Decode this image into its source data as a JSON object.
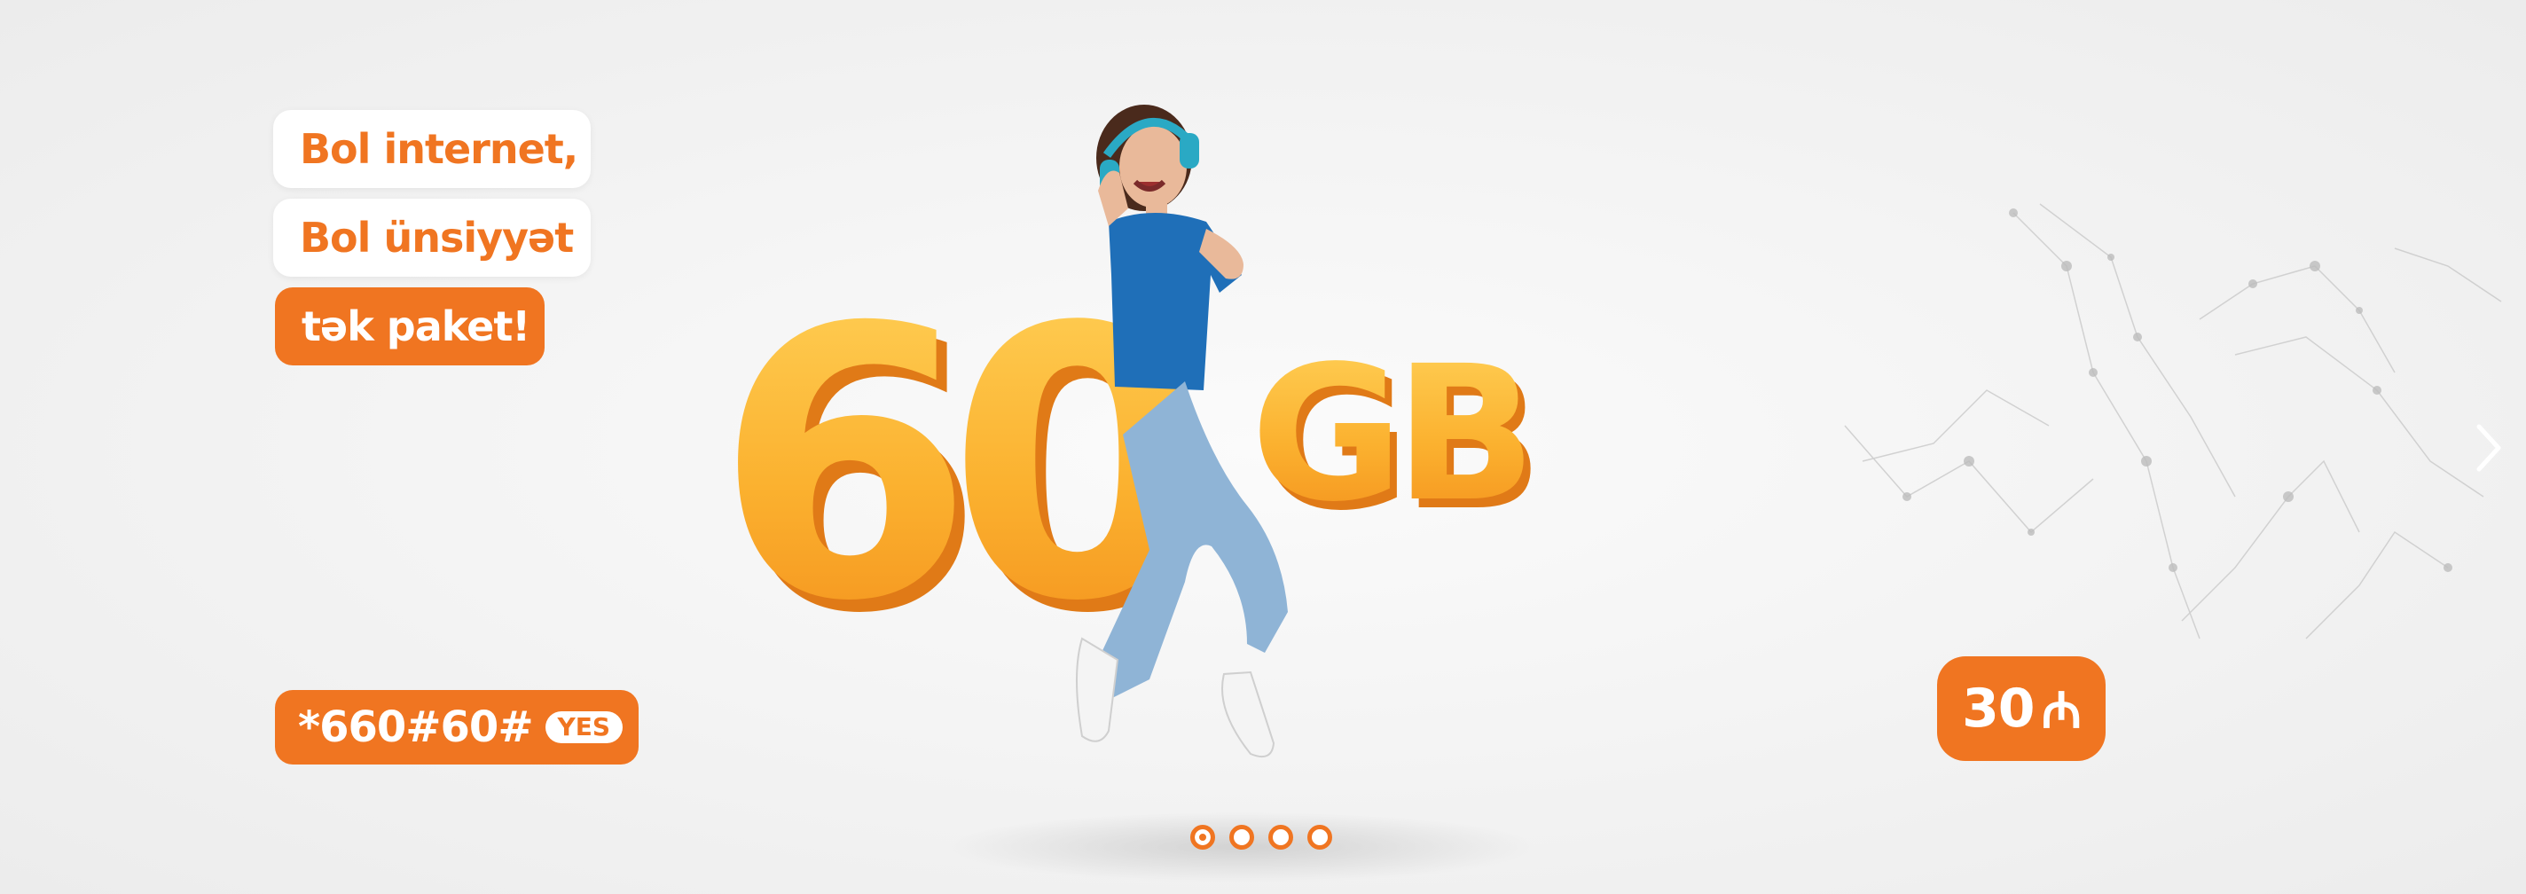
{
  "headline": {
    "line1": "Bol internet,",
    "line2": "Bol ünsiyyət",
    "line3": "tək paket!"
  },
  "hero": {
    "number": "60",
    "unit": "GB"
  },
  "ussd": {
    "code": "*660#60#",
    "badge": "YES"
  },
  "price": {
    "amount": "30",
    "currency": "₼"
  },
  "carousel": {
    "slides": 4,
    "active_slide": 1,
    "next_icon": "chevron-right-icon"
  },
  "colors": {
    "brand_orange": "#f07521",
    "digit_yellow": "#fbb12f",
    "background": "#f2f2f2"
  }
}
